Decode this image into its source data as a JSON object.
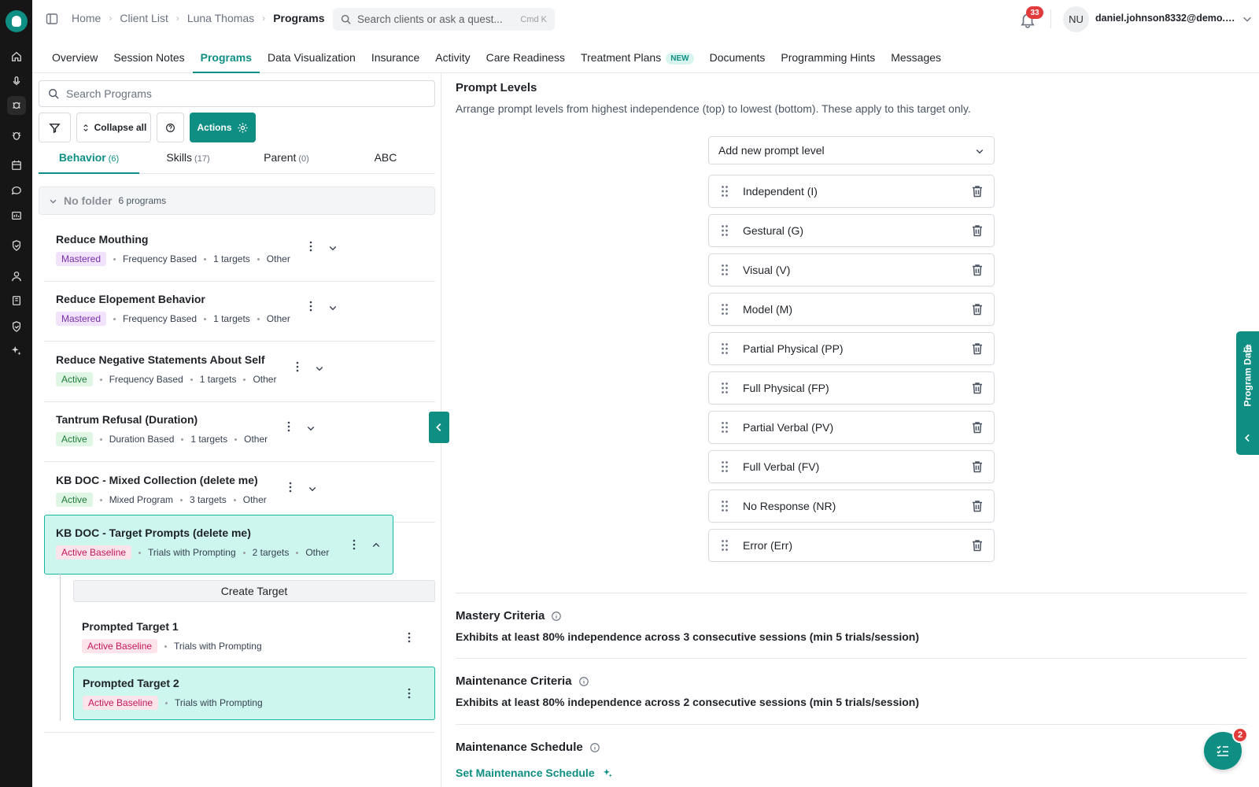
{
  "rail": {
    "items": [
      {
        "icon": "home-icon"
      },
      {
        "icon": "microphone-icon"
      },
      {
        "icon": "clients-icon",
        "active": true
      },
      {
        "icon": "bug-icon"
      },
      {
        "icon": "calendar-icon"
      },
      {
        "icon": "chat-icon"
      },
      {
        "icon": "billing-icon"
      },
      {
        "icon": "shield-icon"
      },
      {
        "icon": "user-icon"
      },
      {
        "icon": "book-icon"
      },
      {
        "icon": "shield-check-icon"
      },
      {
        "icon": "sparkle-icon"
      }
    ]
  },
  "breadcrumb": {
    "items": [
      "Home",
      "Client List",
      "Luna Thomas",
      "Programs"
    ]
  },
  "search": {
    "placeholder": "Search clients or ask a quest...",
    "shortcut": "Cmd K"
  },
  "notifications": {
    "count": "33"
  },
  "user": {
    "initials": "NU",
    "email": "daniel.johnson8332@demo.al..."
  },
  "tabs": [
    {
      "label": "Overview"
    },
    {
      "label": "Session Notes"
    },
    {
      "label": "Programs",
      "active": true
    },
    {
      "label": "Data Visualization"
    },
    {
      "label": "Insurance"
    },
    {
      "label": "Activity"
    },
    {
      "label": "Care Readiness"
    },
    {
      "label": "Treatment Plans",
      "badge": "NEW"
    },
    {
      "label": "Documents"
    },
    {
      "label": "Programming Hints"
    },
    {
      "label": "Messages"
    }
  ],
  "left": {
    "search_placeholder": "Search Programs",
    "collapse_label": "Collapse all",
    "actions_label": "Actions",
    "subtabs": [
      {
        "label": "Behavior",
        "count": "(6)"
      },
      {
        "label": "Skills",
        "count": "(17)"
      },
      {
        "label": "Parent",
        "count": "(0)"
      },
      {
        "label": "ABC",
        "count": ""
      }
    ],
    "folder": {
      "name": "No folder",
      "count": "6 programs"
    },
    "programs": [
      {
        "title": "Reduce Mouthing",
        "status": "Mastered",
        "type": "Frequency Based",
        "targets": "1 targets",
        "category": "Other"
      },
      {
        "title": "Reduce Elopement Behavior",
        "status": "Mastered",
        "type": "Frequency Based",
        "targets": "1 targets",
        "category": "Other"
      },
      {
        "title": "Reduce Negative Statements About Self",
        "status": "Active",
        "type": "Frequency Based",
        "targets": "1 targets",
        "category": "Other"
      },
      {
        "title": "Tantrum Refusal (Duration)",
        "status": "Active",
        "type": "Duration Based",
        "targets": "1 targets",
        "category": "Other"
      },
      {
        "title": "KB DOC - Mixed Collection (delete me)",
        "status": "Active",
        "type": "Mixed Program",
        "targets": "3 targets",
        "category": "Other"
      },
      {
        "title": "KB DOC - Target Prompts (delete me)",
        "status": "Active Baseline",
        "type": "Trials with Prompting",
        "targets": "2 targets",
        "category": "Other"
      }
    ],
    "create_target": "Create Target",
    "targets": [
      {
        "title": "Prompted Target 1",
        "status": "Active Baseline",
        "type": "Trials with Prompting"
      },
      {
        "title": "Prompted Target 2",
        "status": "Active Baseline",
        "type": "Trials with Prompting"
      }
    ]
  },
  "right": {
    "title": "Prompt Levels",
    "description": "Arrange prompt levels from highest independence (top) to lowest (bottom). These apply to this target only.",
    "add_placeholder": "Add new prompt level",
    "levels": [
      "Independent (I)",
      "Gestural (G)",
      "Visual (V)",
      "Model (M)",
      "Partial Physical (PP)",
      "Full Physical (FP)",
      "Partial Verbal (PV)",
      "Full Verbal (FV)",
      "No Response (NR)",
      "Error (Err)"
    ],
    "mastery": {
      "title": "Mastery Criteria",
      "text": "Exhibits at least 80% independence across 3 consecutive sessions (min 5 trials/session)"
    },
    "maintenance": {
      "title": "Maintenance Criteria",
      "text": "Exhibits at least 80% independence across 2 consecutive sessions (min 5 trials/session)"
    },
    "schedule": {
      "title": "Maintenance Schedule",
      "link": "Set Maintenance Schedule"
    }
  },
  "program_data_tab": "Program Data",
  "fab_badge": "2"
}
